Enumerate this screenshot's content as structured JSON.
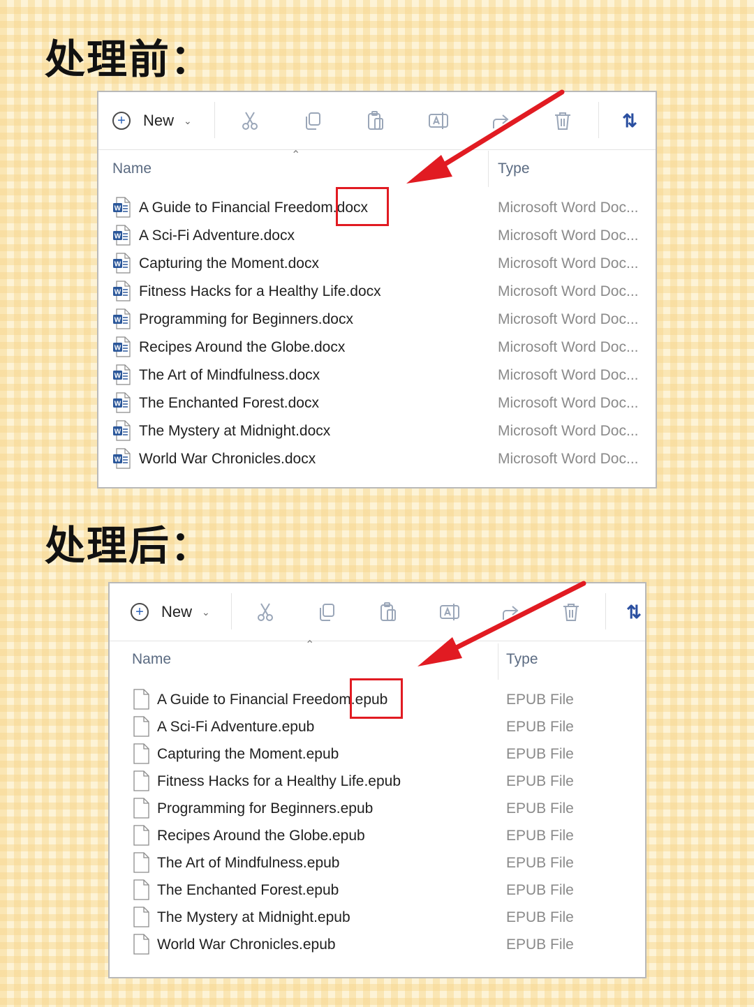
{
  "headings": {
    "before": "处理前：",
    "after": "处理后："
  },
  "toolbar": {
    "new_label": "New"
  },
  "columns": {
    "name": "Name",
    "type": "Type"
  },
  "accent_color": "#e11b22",
  "before": {
    "type_label": "Microsoft Word Doc...",
    "files": [
      "A Guide to Financial Freedom.docx",
      "A Sci-Fi Adventure.docx",
      "Capturing the Moment.docx",
      "Fitness Hacks for a Healthy Life.docx",
      "Programming for Beginners.docx",
      "Recipes Around the Globe.docx",
      "The Art of Mindfulness.docx",
      "The Enchanted Forest.docx",
      "The Mystery at Midnight.docx",
      "World War Chronicles.docx"
    ]
  },
  "after": {
    "type_label": "EPUB File",
    "files": [
      "A Guide to Financial Freedom.epub",
      "A Sci-Fi Adventure.epub",
      "Capturing the Moment.epub",
      "Fitness Hacks for a Healthy Life.epub",
      "Programming for Beginners.epub",
      "Recipes Around the Globe.epub",
      "The Art of Mindfulness.epub",
      "The Enchanted Forest.epub",
      "The Mystery at Midnight.epub",
      "World War Chronicles.epub"
    ]
  }
}
